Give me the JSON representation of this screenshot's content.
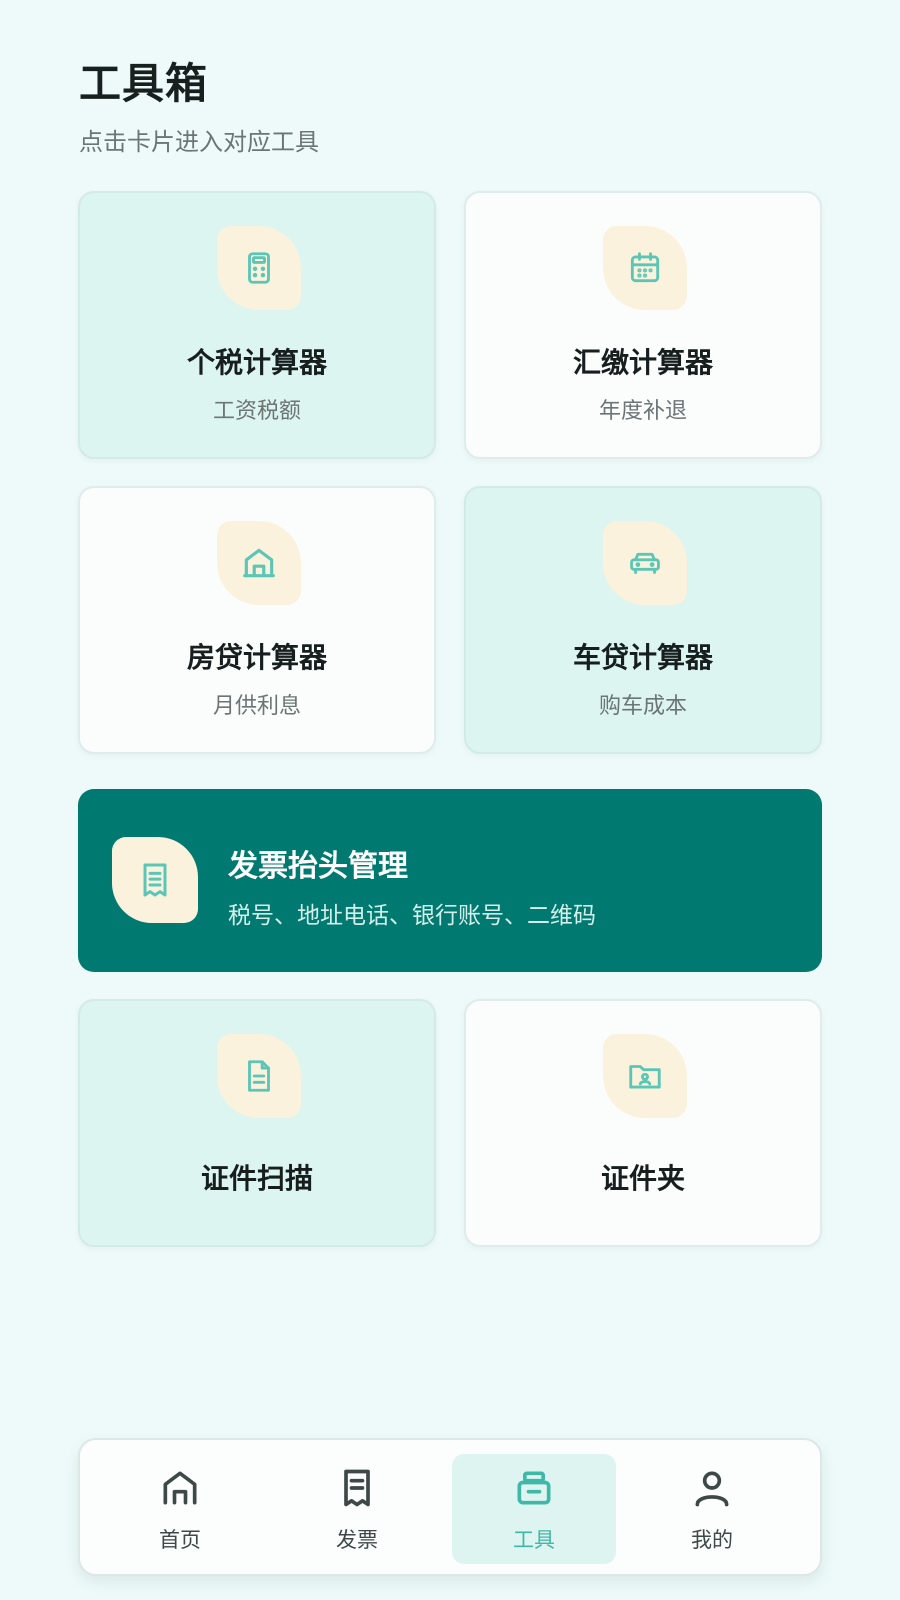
{
  "header": {
    "title": "工具箱",
    "subtitle": "点击卡片进入对应工具"
  },
  "cards": [
    {
      "title": "个税计算器",
      "subtitle": "工资税额",
      "icon": "calculator-icon",
      "tint": "mint"
    },
    {
      "title": "汇缴计算器",
      "subtitle": "年度补退",
      "icon": "calendar-icon",
      "tint": "white"
    },
    {
      "title": "房贷计算器",
      "subtitle": "月供利息",
      "icon": "house-icon",
      "tint": "white"
    },
    {
      "title": "车贷计算器",
      "subtitle": "购车成本",
      "icon": "car-icon",
      "tint": "mint"
    },
    {
      "title": "证件扫描",
      "icon": "document-icon",
      "tint": "mint"
    },
    {
      "title": "证件夹",
      "icon": "folder-id-icon",
      "tint": "white"
    }
  ],
  "banner": {
    "title": "发票抬头管理",
    "subtitle": "税号、地址电话、银行账号、二维码",
    "icon": "receipt-icon",
    "color": "#007a70"
  },
  "tabbar": {
    "items": [
      {
        "label": "首页",
        "icon": "home-icon"
      },
      {
        "label": "发票",
        "icon": "receipt-icon"
      },
      {
        "label": "工具",
        "icon": "toolbox-icon",
        "active": true
      },
      {
        "label": "我的",
        "icon": "user-icon"
      }
    ]
  },
  "colors": {
    "accent": "#3fb8a8",
    "icon_bg": "#fbf2dd",
    "card_mint": "#dcf5f1",
    "banner": "#007a70"
  }
}
